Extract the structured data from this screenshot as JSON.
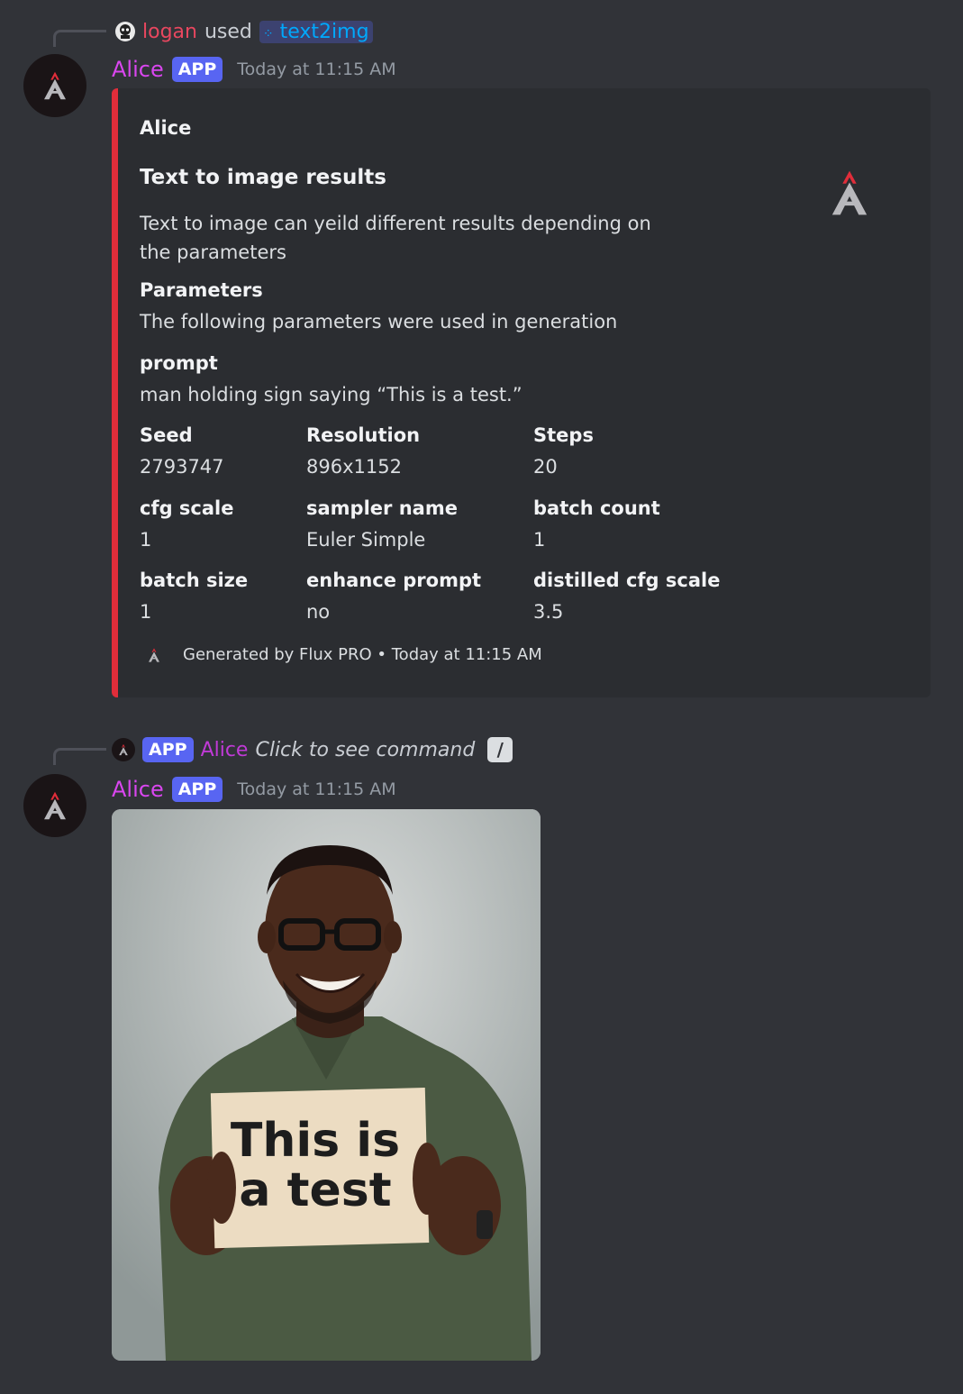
{
  "message1": {
    "interaction": {
      "user": "logan",
      "used_text": "used",
      "command": "text2img"
    },
    "author": "Alice",
    "badge": "APP",
    "timestamp": "Today at 11:15 AM",
    "embed": {
      "author": "Alice",
      "title": "Text to image results",
      "description": "Text to image can yeild different results depending on the parameters",
      "parameters_heading": "Parameters",
      "parameters_text": "The following parameters were used in generation",
      "prompt_label": "prompt",
      "prompt_value": "man holding sign saying “This is a test.”",
      "fields": [
        {
          "name": "Seed",
          "value": "2793747"
        },
        {
          "name": "Resolution",
          "value": "896x1152"
        },
        {
          "name": "Steps",
          "value": "20"
        },
        {
          "name": "cfg scale",
          "value": "1"
        },
        {
          "name": "sampler name",
          "value": "Euler Simple"
        },
        {
          "name": "batch count",
          "value": "1"
        },
        {
          "name": "batch size",
          "value": "1"
        },
        {
          "name": "enhance prompt",
          "value": "no"
        },
        {
          "name": "distilled cfg scale",
          "value": "3.5"
        }
      ],
      "footer": "Generated by Flux PRO • Today at 11:15 AM",
      "accent_color": "#e12d3a"
    }
  },
  "message2": {
    "reply": {
      "badge": "APP",
      "author": "Alice",
      "text": "Click to see command"
    },
    "author": "Alice",
    "badge": "APP",
    "timestamp": "Today at 11:15 AM",
    "image": {
      "sign_line1": "This is",
      "sign_line2": "a test"
    }
  },
  "colors": {
    "background": "#313338",
    "embed_background": "#2b2d31",
    "author_color": "#d946ef",
    "user_color": "#e8475f",
    "app_badge": "#5865f2",
    "link": "#00a8fc"
  }
}
